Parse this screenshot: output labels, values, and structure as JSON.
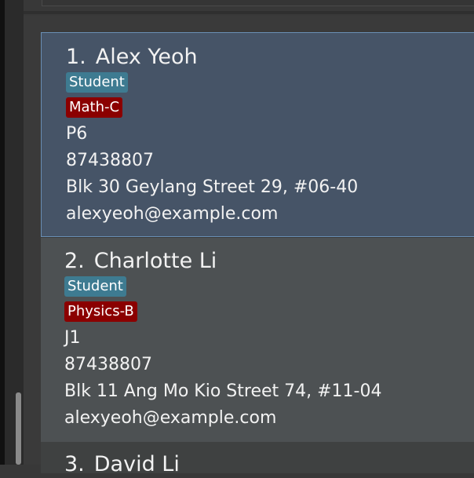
{
  "persons": [
    {
      "index": "1.",
      "name": "Alex Yeoh",
      "role_tag": "Student",
      "subject_tag": "Math-C",
      "level": "P6",
      "phone": "87438807",
      "address": "Blk 30 Geylang Street 29, #06-40",
      "email": "alexyeoh@example.com"
    },
    {
      "index": "2.",
      "name": "Charlotte Li",
      "role_tag": "Student",
      "subject_tag": "Physics-B",
      "level": "J1",
      "phone": "87438807",
      "address": "Blk 11 Ang Mo Kio Street 74, #11-04",
      "email": "alexyeoh@example.com"
    },
    {
      "index": "3.",
      "name": "David Li"
    }
  ],
  "colors": {
    "selected_card_bg": "#465467",
    "card_bg": "#4d5153",
    "role_tag_bg": "#3e7b91",
    "subject_tag_bg": "#8b0000"
  }
}
